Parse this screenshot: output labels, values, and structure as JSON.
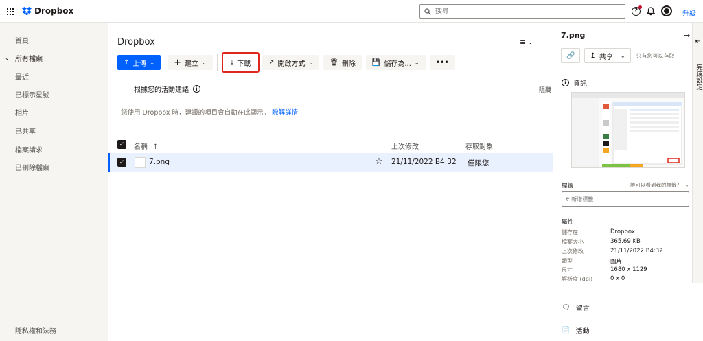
{
  "topbar": {
    "brand": "Dropbox",
    "search_placeholder": "搜尋",
    "upgrade_label": "升級",
    "brand_color": "#0061fe"
  },
  "sidebar": {
    "items": [
      {
        "label": "首頁"
      },
      {
        "label": "所有檔案"
      },
      {
        "label": "最近"
      },
      {
        "label": "已標示星號"
      },
      {
        "label": "相片"
      },
      {
        "label": "已共享"
      },
      {
        "label": "檔案請求"
      },
      {
        "label": "已刪除檔案"
      }
    ],
    "footer": "隱私權和法務"
  },
  "main": {
    "title": "Dropbox",
    "toolbar": {
      "upload": "上傳",
      "create": "建立",
      "download": "下載",
      "open_with": "開啟方式",
      "delete": "刪除",
      "save_as": "儲存為..."
    },
    "suggestions": {
      "heading": "根據您的活動建議",
      "hide": "隱藏",
      "body": "您使用 Dropbox 時，建議的項目會自動在此顯示。",
      "learn_more": "瞭解詳情"
    },
    "table": {
      "columns": [
        "名稱",
        "上次修改",
        "存取對象"
      ],
      "rows": [
        {
          "name": "7.png",
          "modified": "21/11/2022 B4:32",
          "access": "僅限您"
        }
      ]
    }
  },
  "panel": {
    "title": "7.png",
    "share": "共享",
    "only_you": "只有您可以存取",
    "info": "資訊",
    "tags_label": "標籤",
    "tags_help": "誰可以看到我的標籤？",
    "tag_placeholder": "# 新增標籤",
    "props_label": "屬性",
    "properties": [
      {
        "key": "儲存在",
        "value": "Dropbox"
      },
      {
        "key": "檔案大小",
        "value": "365.69 KB"
      },
      {
        "key": "上次修改",
        "value": "21/11/2022 B4:32"
      },
      {
        "key": "類型",
        "value": "圖片"
      },
      {
        "key": "尺寸",
        "value": "1680 x 1129"
      },
      {
        "key": "解析度 (dpi)",
        "value": "0 x 0"
      }
    ],
    "comments": "留言",
    "activity": "活動"
  },
  "sidepane": {
    "label": "完成設定"
  }
}
